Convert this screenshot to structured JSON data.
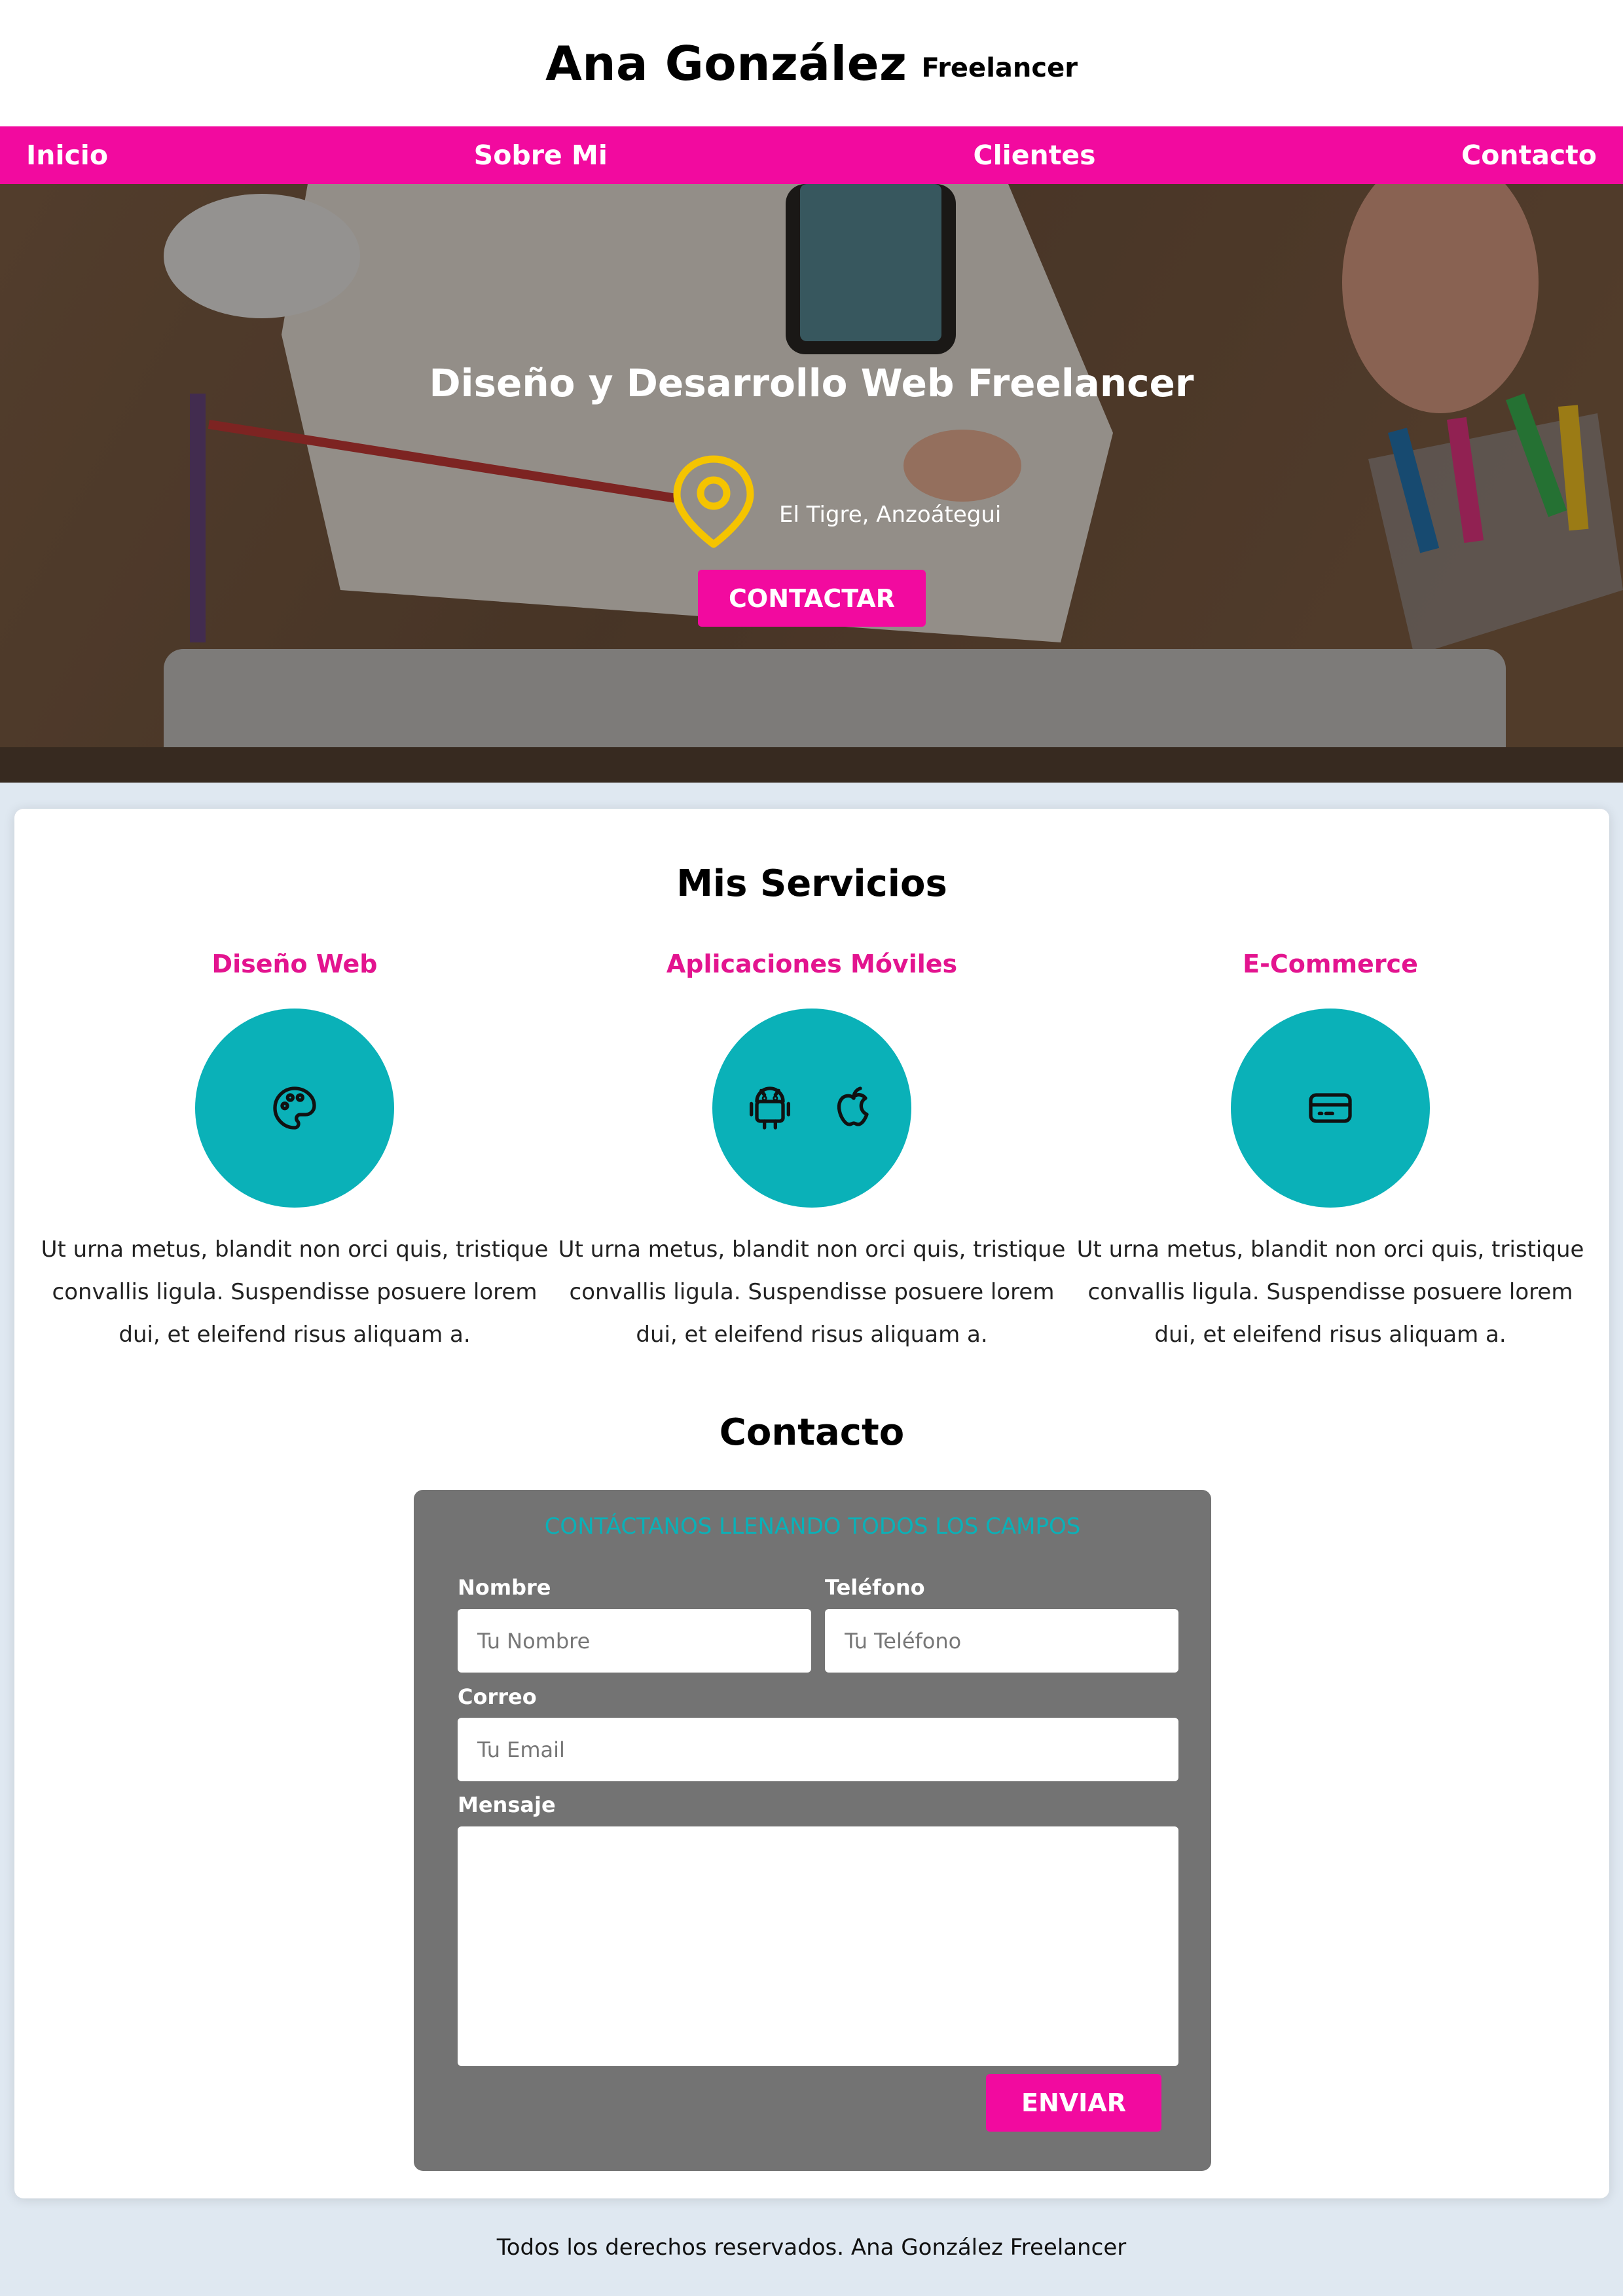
{
  "header": {
    "name": "Ana González",
    "tagline": "Freelancer"
  },
  "nav": {
    "items": [
      {
        "label": "Inicio"
      },
      {
        "label": "Sobre Mi"
      },
      {
        "label": "Clientes"
      },
      {
        "label": "Contacto"
      }
    ]
  },
  "hero": {
    "title": "Diseño y Desarrollo Web Freelancer",
    "location": "El Tigre, Anzoátegui",
    "cta_label": "CONTACTAR",
    "icon": "map-pin-icon"
  },
  "services": {
    "heading": "Mis Servicios",
    "items": [
      {
        "title": "Diseño Web",
        "icons": [
          "palette-icon"
        ],
        "text": "Ut urna metus, blandit non orci quis, tristique convallis ligula. Suspendisse posuere lorem dui, et eleifend risus aliquam a."
      },
      {
        "title": "Aplicaciones Móviles",
        "icons": [
          "android-icon",
          "apple-icon"
        ],
        "text": "Ut urna metus, blandit non orci quis, tristique convallis ligula. Suspendisse posuere lorem dui, et eleifend risus aliquam a."
      },
      {
        "title": "E-Commerce",
        "icons": [
          "credit-card-icon"
        ],
        "text": "Ut urna metus, blandit non orci quis, tristique convallis ligula. Suspendisse posuere lorem dui, et eleifend risus aliquam a."
      }
    ]
  },
  "contact": {
    "heading": "Contacto",
    "form_heading": "CONTÁCTANOS LLENANDO TODOS LOS CAMPOS",
    "fields": {
      "name": {
        "label": "Nombre",
        "placeholder": "Tu Nombre",
        "value": ""
      },
      "phone": {
        "label": "Teléfono",
        "placeholder": "Tu Teléfono",
        "value": ""
      },
      "email": {
        "label": "Correo",
        "placeholder": "Tu Email",
        "value": ""
      },
      "message": {
        "label": "Mensaje",
        "placeholder": "",
        "value": ""
      }
    },
    "submit_label": "ENVIAR"
  },
  "footer": {
    "text": "Todos los derechos reservados. Ana González Freelancer"
  },
  "colors": {
    "brand_pink": "#f20a9f",
    "teal": "#0ab1b8",
    "form_gray": "#737373",
    "page_bg": "#dfe8f1",
    "pin_yellow": "#f5c400"
  }
}
